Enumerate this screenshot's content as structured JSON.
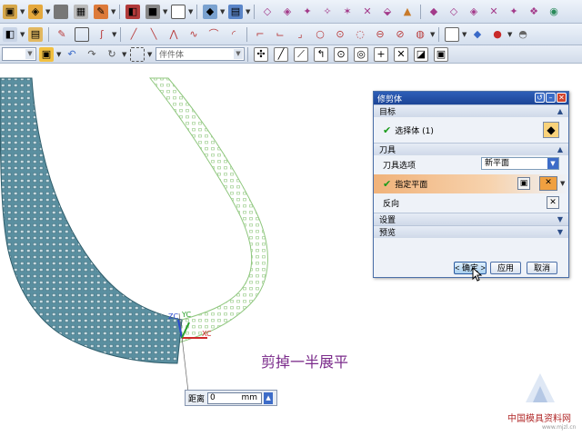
{
  "toolbar_row3": {
    "filter_combo": "",
    "filter2_combo": "伴件体"
  },
  "dialog": {
    "title": "修剪体",
    "target": {
      "section_label": "目标",
      "select_label": "选择体 (1)"
    },
    "tool": {
      "section_label": "刀具",
      "option_label": "刀具选项",
      "option_value": "新平面",
      "plane_label": "指定平面",
      "reverse_label": "反向"
    },
    "settings_label": "设置",
    "preview_label": "预览",
    "buttons": {
      "ok": "< 确定 >",
      "apply": "应用",
      "cancel": "取消"
    }
  },
  "distance": {
    "label": "距离",
    "value": "0",
    "unit": "mm"
  },
  "viewport": {
    "axis_zc": "ZC",
    "axis_yc": "YC",
    "axis_xc": "XC"
  },
  "caption": "剪掉一半展平",
  "watermark": "中国模具资料网",
  "watermark_url": "www.mjzl.cn",
  "colors": {
    "solid_part": "#5a8fa0",
    "ghost_part": "#9ad08a",
    "caption": "#7a2a8a",
    "dialog_title": "#1c4496"
  }
}
